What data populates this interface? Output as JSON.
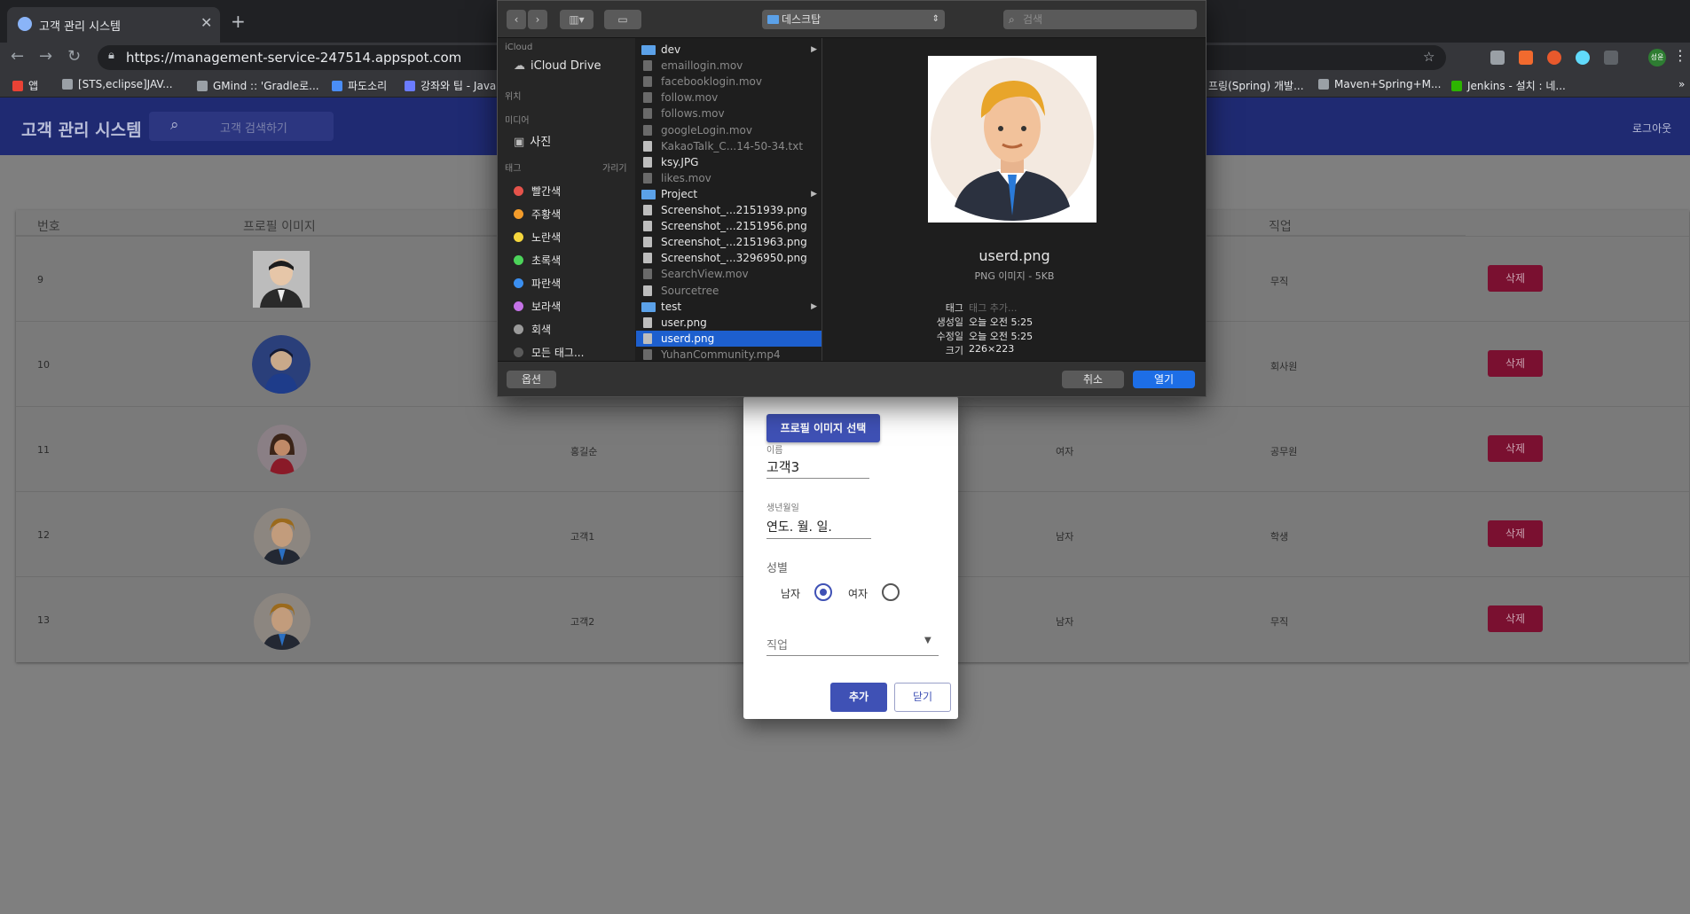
{
  "browser": {
    "tab_title": "고객 관리 시스템",
    "url": "https://management-service-247514.appspot.com",
    "bookmarks": [
      "앱",
      "[STS,eclipse]JAV...",
      "GMind :: 'Gradle로...",
      "파도소리",
      "강좌와 팁 - Java",
      "프링(Spring) 개발...",
      "Maven+Spring+M...",
      "Jenkins - 설치 : 네..."
    ],
    "profile_badge": "성윤"
  },
  "app": {
    "title": "고객 관리 시스템",
    "search_placeholder": "고객 검색하기",
    "logout": "로그아웃"
  },
  "table": {
    "headers": [
      "번호",
      "프로필 이미지",
      "직업"
    ],
    "delete_label": "삭제",
    "rows": [
      {
        "id": "9",
        "name": "",
        "gender": "",
        "job": "무직",
        "avatar": "photo"
      },
      {
        "id": "10",
        "name": "",
        "gender": "",
        "job": "회사원",
        "avatar": "blue"
      },
      {
        "id": "11",
        "name": "홍길순",
        "gender": "여자",
        "job": "공무원",
        "avatar": "woman"
      },
      {
        "id": "12",
        "name": "고객1",
        "gender": "남자",
        "job": "학생",
        "avatar": "man"
      },
      {
        "id": "13",
        "name": "고객2",
        "gender": "남자",
        "job": "무직",
        "avatar": "man"
      }
    ]
  },
  "dialog": {
    "pick_image": "프로필 이미지 선택",
    "name_label": "이름",
    "name_value": "고객3",
    "birth_label": "생년월일",
    "birth_value": "연도. 월. 일.",
    "gender_label": "성별",
    "male": "남자",
    "female": "여자",
    "gender_selected": "남자",
    "job_label": "직업",
    "add": "추가",
    "close": "닫기"
  },
  "file_dialog": {
    "location": "데스크탑",
    "search_placeholder": "검색",
    "sidebar": {
      "icloud_header": "iCloud",
      "icloud_drive": "iCloud Drive",
      "locations_header": "위치",
      "media_header": "미디어",
      "photos": "사진",
      "tags_header": "태그",
      "hide": "가리기",
      "tags": [
        {
          "label": "빨간색",
          "color": "#e5534b"
        },
        {
          "label": "주황색",
          "color": "#f39c2b"
        },
        {
          "label": "노란색",
          "color": "#f5d63d"
        },
        {
          "label": "초록색",
          "color": "#4cd35a"
        },
        {
          "label": "파란색",
          "color": "#3b8ff0"
        },
        {
          "label": "보라색",
          "color": "#c472e6"
        },
        {
          "label": "회색",
          "color": "#9a9a9a"
        },
        {
          "label": "모든 태그...",
          "color": "#5a5a5a"
        }
      ]
    },
    "files": [
      {
        "name": "dev",
        "kind": "folder",
        "dim": false
      },
      {
        "name": "emaillogin.mov",
        "kind": "video",
        "dim": true
      },
      {
        "name": "facebooklogin.mov",
        "kind": "video",
        "dim": true
      },
      {
        "name": "follow.mov",
        "kind": "video",
        "dim": true
      },
      {
        "name": "follows.mov",
        "kind": "video",
        "dim": true
      },
      {
        "name": "googleLogin.mov",
        "kind": "video",
        "dim": true
      },
      {
        "name": "KakaoTalk_C...14-50-34.txt",
        "kind": "file",
        "dim": true
      },
      {
        "name": "ksy.JPG",
        "kind": "file",
        "dim": false
      },
      {
        "name": "likes.mov",
        "kind": "video",
        "dim": true
      },
      {
        "name": "Project",
        "kind": "folder",
        "dim": false
      },
      {
        "name": "Screenshot_...2151939.png",
        "kind": "file",
        "dim": false
      },
      {
        "name": "Screenshot_...2151956.png",
        "kind": "file",
        "dim": false
      },
      {
        "name": "Screenshot_...2151963.png",
        "kind": "file",
        "dim": false
      },
      {
        "name": "Screenshot_...3296950.png",
        "kind": "file",
        "dim": false
      },
      {
        "name": "SearchView.mov",
        "kind": "video",
        "dim": true
      },
      {
        "name": "Sourcetree",
        "kind": "app",
        "dim": true
      },
      {
        "name": "test",
        "kind": "folder",
        "dim": false
      },
      {
        "name": "user.png",
        "kind": "file",
        "dim": false
      },
      {
        "name": "userd.png",
        "kind": "file",
        "dim": false,
        "selected": true
      },
      {
        "name": "YuhanCommunity.mp4",
        "kind": "video",
        "dim": true
      }
    ],
    "preview": {
      "name": "userd.png",
      "kind": "PNG 이미지 - 5KB",
      "tags_label": "태그",
      "tags_placeholder": "태그 추가...",
      "created_label": "생성일",
      "created": "오늘 오전 5:25",
      "modified_label": "수정일",
      "modified": "오늘 오전 5:25",
      "size_label": "크기",
      "size": "226×223"
    },
    "options": "옵션",
    "cancel": "취소",
    "open": "열기"
  }
}
